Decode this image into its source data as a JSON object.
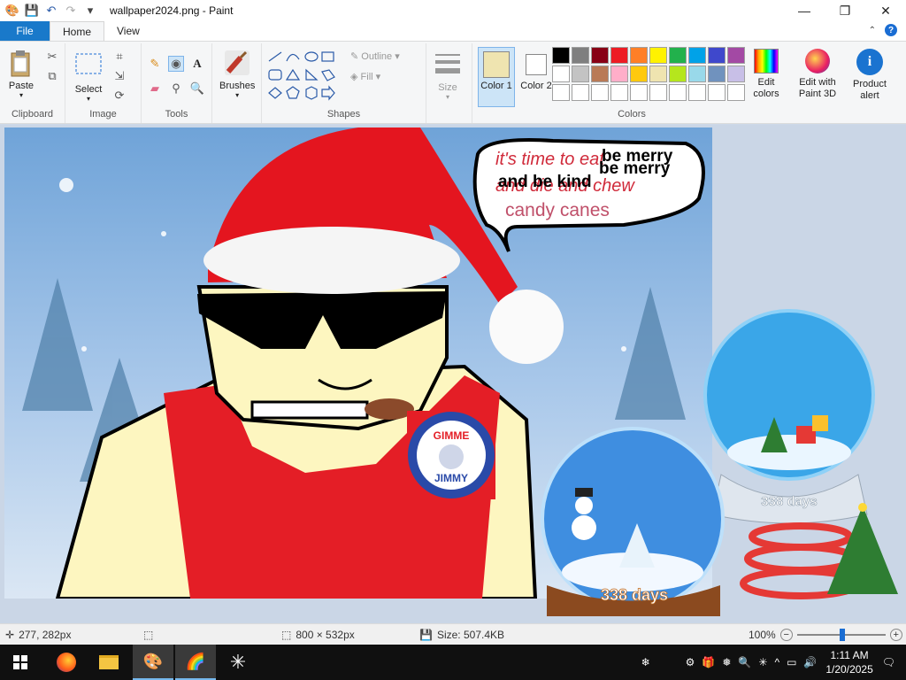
{
  "window": {
    "title": "wallpaper2024.png - Paint",
    "controls": {
      "minimize": "—",
      "maximize": "❐",
      "close": "✕"
    }
  },
  "tabs": {
    "file": "File",
    "home": "Home",
    "view": "View"
  },
  "ribbon": {
    "clipboard": {
      "paste": "Paste",
      "label": "Clipboard"
    },
    "image": {
      "select": "Select",
      "label": "Image"
    },
    "tools": {
      "label": "Tools"
    },
    "brushes": {
      "label": "Brushes"
    },
    "shapes": {
      "label": "Shapes",
      "outline": "Outline",
      "fill": "Fill"
    },
    "size": {
      "label": "Size"
    },
    "colors": {
      "color1": "Color 1",
      "color2": "Color 2",
      "label": "Colors",
      "edit_colors": "Edit colors",
      "edit_paint3d": "Edit with Paint 3D",
      "product_alert": "Product alert",
      "color1_value": "#efe4b0",
      "color2_value": "#ffffff",
      "palette_row1": [
        "#000000",
        "#7f7f7f",
        "#880015",
        "#ed1c24",
        "#ff7f27",
        "#fff200",
        "#22b14c",
        "#00a2e8",
        "#3f48cc",
        "#a349a4"
      ],
      "palette_row2": [
        "#ffffff",
        "#c3c3c3",
        "#b97a57",
        "#ffaec9",
        "#ffc90e",
        "#efe4b0",
        "#b5e61d",
        "#99d9ea",
        "#7092be",
        "#c8bfe7"
      ]
    }
  },
  "canvas": {
    "speech_red": "it's time to eat",
    "speech_red2": "and die and chew",
    "speech_pink": "candy canes",
    "speech_black1": "be merry",
    "speech_black2": "be merry",
    "speech_black3": "and be kind",
    "badge_top": "GIMME",
    "badge_bottom": "JIMMY",
    "globe_days1": "338 days",
    "globe_days2": "338 days"
  },
  "status": {
    "cursor_pos": "277, 282px",
    "dimensions": "800 × 532px",
    "size": "Size: 507.4KB",
    "zoom": "100%"
  },
  "taskbar": {
    "time": "1:11 AM",
    "date": "1/20/2025"
  }
}
